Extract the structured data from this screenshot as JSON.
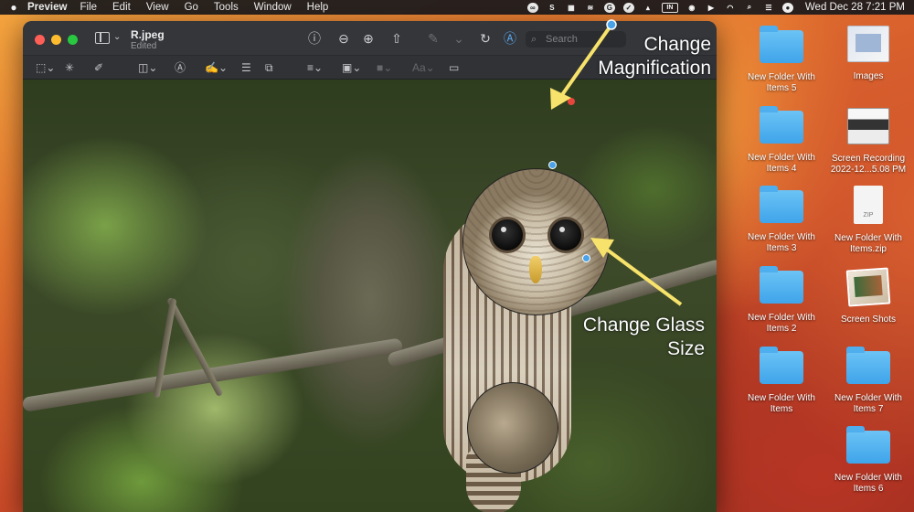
{
  "menubar": {
    "apple": "",
    "app_name": "Preview",
    "menus": [
      "File",
      "Edit",
      "View",
      "Go",
      "Tools",
      "Window",
      "Help"
    ],
    "tray_in_label": "IN",
    "clock": "Wed Dec 28  7:21 PM"
  },
  "window": {
    "doc_name": "R.jpeg",
    "doc_status": "Edited",
    "search_placeholder": "Search",
    "toolbar_icons": [
      "info-icon",
      "zoom-out-icon",
      "zoom-in-icon",
      "share-icon",
      "markup-pen-icon",
      "rotate-icon",
      "markup-icon",
      "search-icon"
    ],
    "markup_icons": [
      "rect-select-icon",
      "instant-alpha-icon",
      "sketch-icon",
      "shapes-icon",
      "text-icon",
      "sign-icon",
      "adjust-color-icon",
      "adjust-size-icon",
      "line-style-icon",
      "border-color-icon",
      "fill-color-icon",
      "text-style-icon",
      "note-icon"
    ]
  },
  "annotations": {
    "magnification_line1": "Change",
    "magnification_line2": "Magnification",
    "glass_size_line1": "Change Glass",
    "glass_size_line2": "Size",
    "arrow_color": "#f7e26b"
  },
  "desktop": {
    "items": [
      {
        "label": "New Folder With Items 5",
        "kind": "folder"
      },
      {
        "label": "Images",
        "kind": "images"
      },
      {
        "label": "New Folder With Items 4",
        "kind": "folder"
      },
      {
        "label": "Screen Recording 2022-12...5.08 PM",
        "kind": "screen"
      },
      {
        "label": "New Folder With Items 3",
        "kind": "folder"
      },
      {
        "label": "New Folder With Items.zip",
        "kind": "zip"
      },
      {
        "label": "New Folder With Items 2",
        "kind": "folder"
      },
      {
        "label": "Screen Shots",
        "kind": "shots"
      },
      {
        "label": "New Folder With Items",
        "kind": "folder"
      },
      {
        "label": "New Folder With Items 7",
        "kind": "folder"
      },
      {
        "label": "New Folder With Items 6",
        "kind": "folder"
      }
    ]
  }
}
